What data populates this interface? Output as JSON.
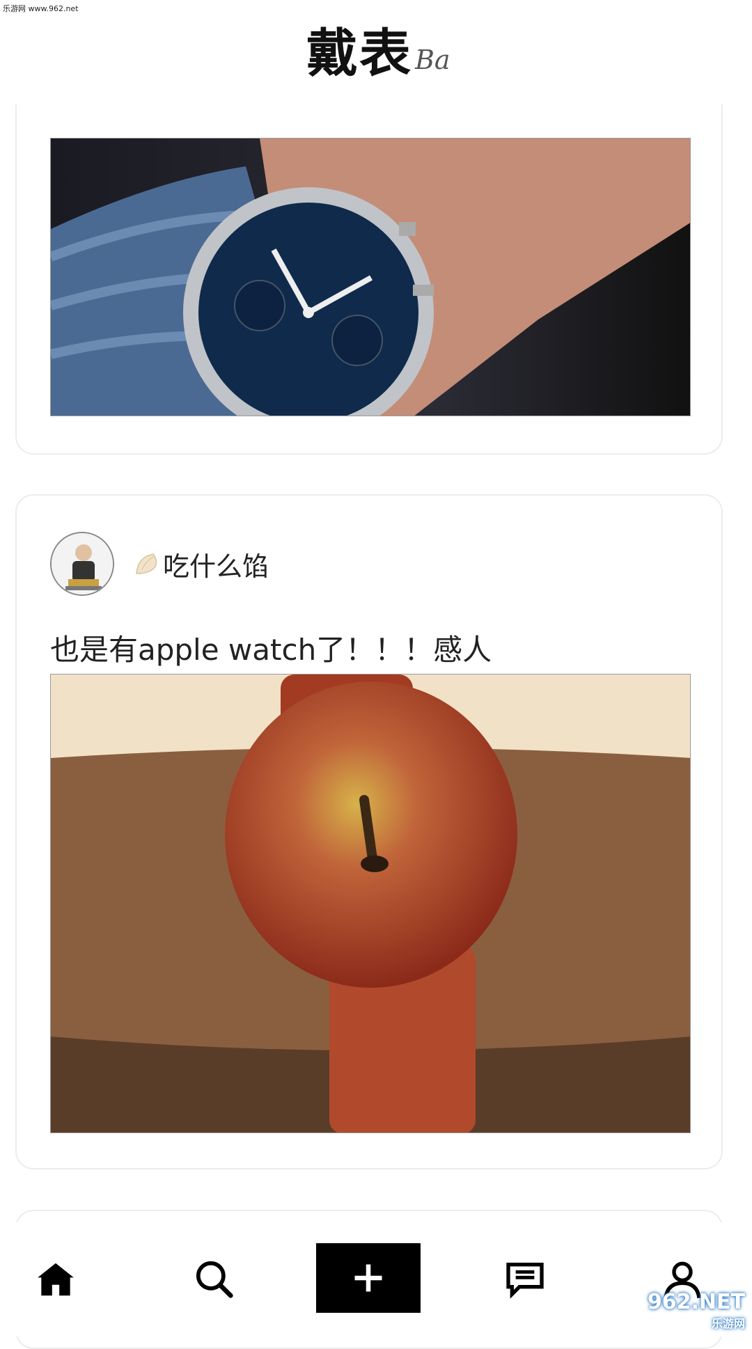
{
  "status": {
    "watermark_top": "乐游网 www.962.net"
  },
  "header": {
    "brand_cn": "戴表",
    "brand_script": "Ba"
  },
  "posts": [
    {
      "image_desc": "watch-on-wrist-photo"
    },
    {
      "author": "吃什么馅",
      "text": "也是有apple watch了！！！感人",
      "image_desc": "apple-watch-joke-photo"
    }
  ],
  "nav": {
    "items": [
      {
        "icon": "home-icon"
      },
      {
        "icon": "search-icon"
      },
      {
        "icon": "plus-icon"
      },
      {
        "icon": "message-icon"
      },
      {
        "icon": "profile-icon"
      }
    ]
  },
  "watermark_bottom": {
    "main": "962.NET",
    "sub": "乐游网"
  },
  "colors": {
    "accent": "#000000",
    "card_border": "#ececec"
  }
}
